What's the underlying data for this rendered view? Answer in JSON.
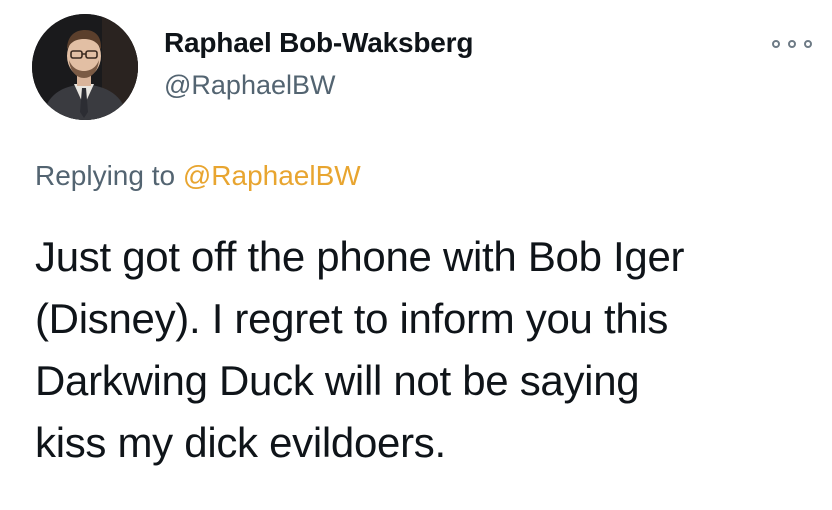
{
  "author": {
    "display_name": "Raphael Bob-Waksberg",
    "handle": "@RaphaelBW",
    "avatar_icon": "profile-photo"
  },
  "more_icon": "more-options-icon",
  "reply": {
    "prefix": "Replying to",
    "mention": "@RaphaelBW"
  },
  "tweet": {
    "lines": [
      "Just got off the phone with Bob Iger",
      "(Disney). I regret to inform you this",
      "Darkwing Duck will not be saying",
      "kiss my dick evildoers."
    ]
  },
  "colors": {
    "mention": "#e8a530",
    "secondary_text": "#536471",
    "primary_text": "#0f1419"
  }
}
